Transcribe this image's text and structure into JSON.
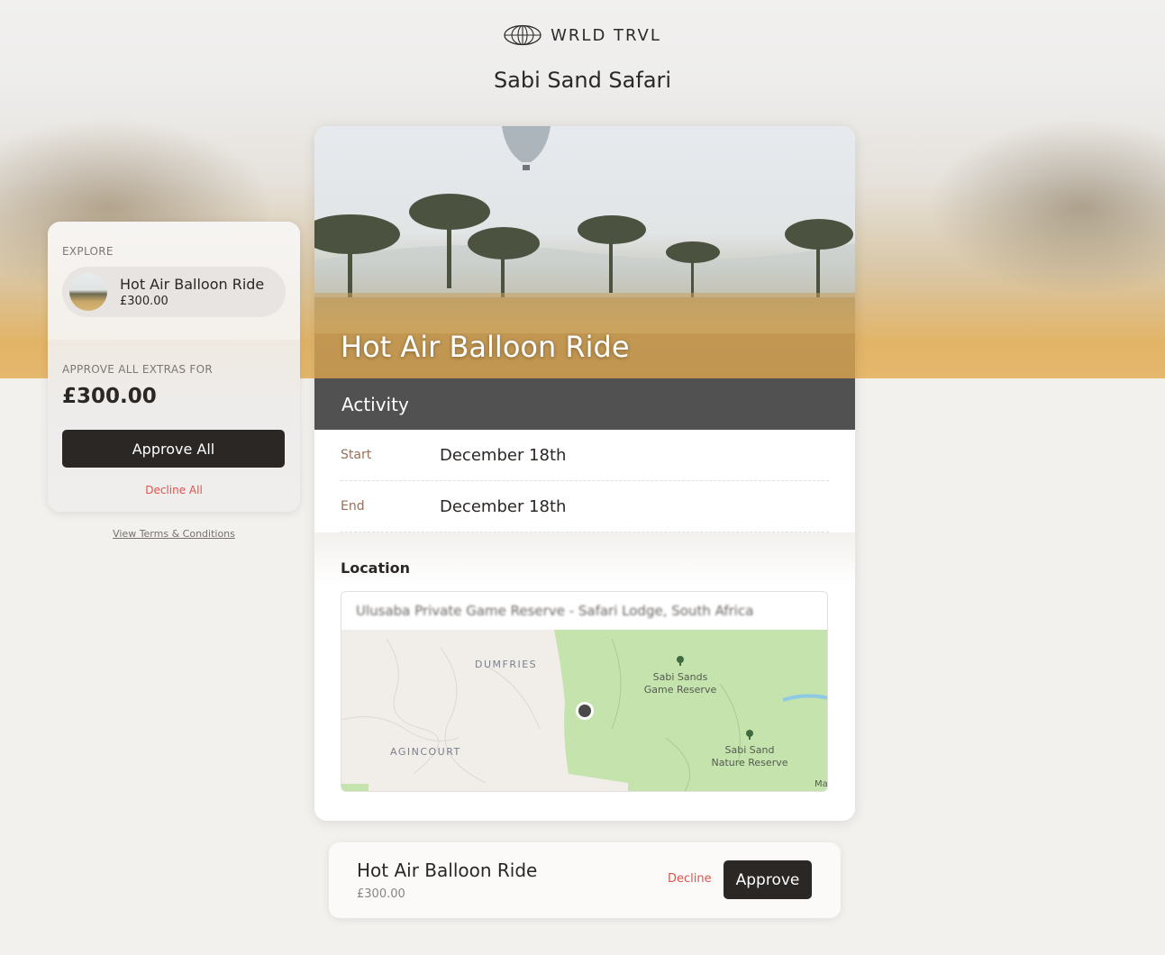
{
  "brand": {
    "name": "WRLD TRVL",
    "logo_icon": "globe-icon"
  },
  "page": {
    "title": "Sabi Sand Safari"
  },
  "sidebar": {
    "explore_label": "EXPLORE",
    "explore_item": {
      "title": "Hot Air Balloon Ride",
      "price": "£300.00"
    },
    "approve_label": "APPROVE ALL EXTRAS FOR",
    "total": "£300.00",
    "approve_all_label": "Approve All",
    "decline_all_label": "Decline All",
    "terms_label": "View Terms & Conditions"
  },
  "activity": {
    "title": "Hot Air Balloon Ride",
    "type": "Activity",
    "start_label": "Start",
    "start_value": "December 18th",
    "end_label": "End",
    "end_value": "December 18th",
    "location_label": "Location",
    "address": "Ulusaba Private Game Reserve - Safari Lodge, South Africa",
    "map_labels": {
      "dumfries": "DUMFRIES",
      "agincourt": "AGINCOURT",
      "sabi_sands_1": "Sabi Sands",
      "sabi_sands_2": "Game Reserve",
      "sabi_sand_1": "Sabi Sand",
      "sabi_sand_2": "Nature Reserve",
      "edge": "Ma"
    }
  },
  "footer_bar": {
    "title": "Hot Air Balloon Ride",
    "price": "£300.00",
    "decline_label": "Decline",
    "approve_label": "Approve"
  },
  "colors": {
    "dark": "#2a2725",
    "decline_red": "#e0524a",
    "section_bar": "#515151",
    "label_brown": "#9a7058",
    "map_green": "#c5e3ad"
  }
}
